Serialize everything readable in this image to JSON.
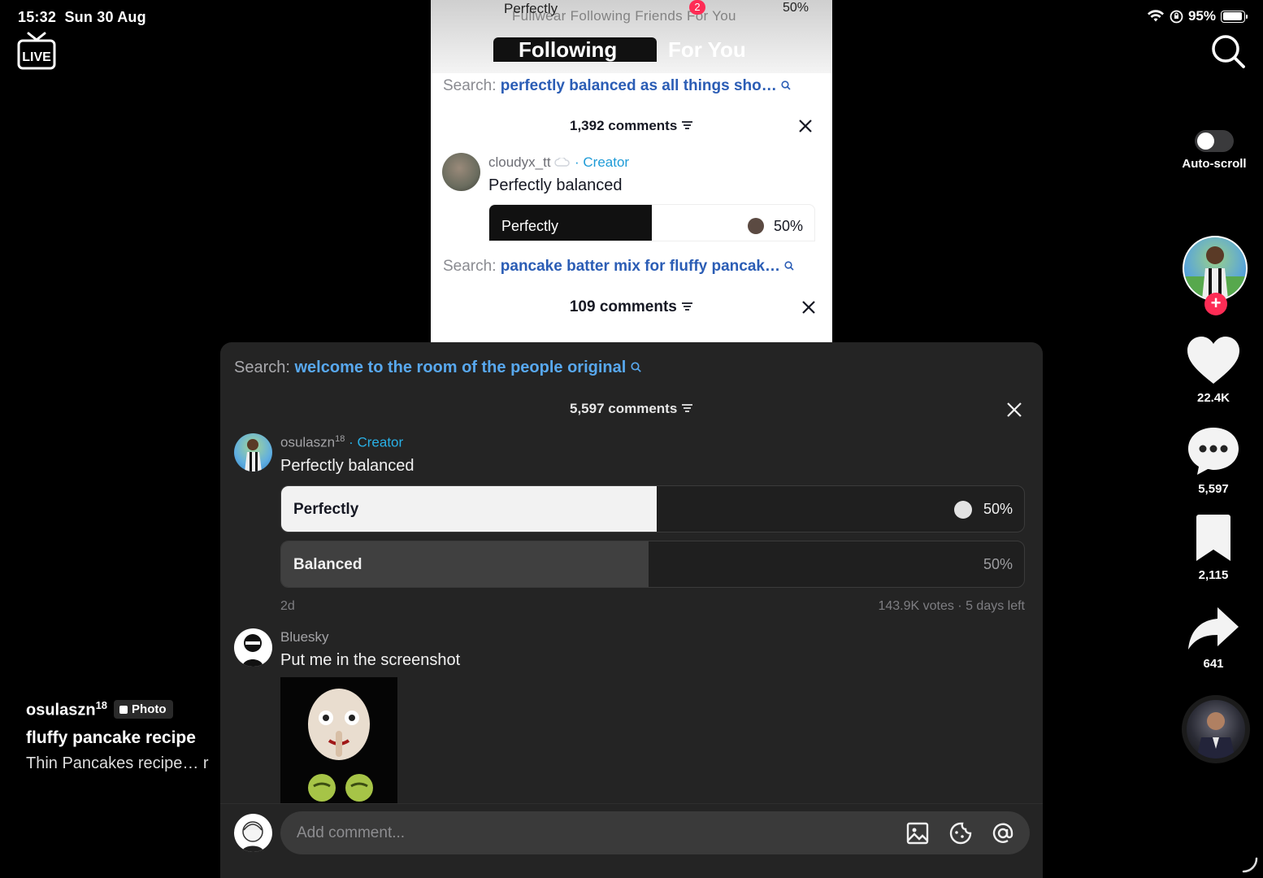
{
  "status": {
    "time": "15:32",
    "date": "Sun 30 Aug",
    "battery": "95%",
    "battery_level": 0.95
  },
  "top": {
    "live_icon": "live-tv-icon",
    "search_icon": "search-icon"
  },
  "autoscroll": {
    "label": "Auto-scroll",
    "enabled": false
  },
  "rail": {
    "likes": "22.4K",
    "comments": "5,597",
    "saves": "2,115",
    "shares": "641"
  },
  "caption": {
    "author": "osulaszn",
    "author_sup": "18",
    "badge": "Photo",
    "title": "fluffy pancake recipe",
    "desc": "Thin Pancakes recipe… r"
  },
  "screenshot": {
    "top_left_label": "Perfectly",
    "top_pct": "50%",
    "top_tabs": "Fullwear  Following  Friends  For You",
    "badge": "2",
    "following": "Following",
    "for_you": "For You",
    "search1_prefix": "Search:",
    "search1_query": "perfectly balanced as all things sho…",
    "count1": "1,392 comments",
    "user": "cloudyx_tt",
    "creator": "· Creator",
    "text": "Perfectly balanced",
    "poll_label": "Perfectly",
    "poll_pct": "50%",
    "poll_fill": 0.5,
    "search2_prefix": "Search:",
    "search2_query": "pancake batter mix for fluffy pancak…",
    "count2": "109 comments"
  },
  "panel": {
    "search_prefix": "Search:",
    "search_query": "welcome to the room of the people original",
    "count": "5,597 comments",
    "comments": [
      {
        "user": "osulaszn",
        "user_sup": "18",
        "creator": "· Creator",
        "text": "Perfectly balanced",
        "poll": [
          {
            "label": "Perfectly",
            "pct": "50%",
            "fill": 0.505,
            "selected": true
          },
          {
            "label": "Balanced",
            "pct": "50%",
            "fill": 0.495,
            "selected": false
          }
        ],
        "age": "2d",
        "votes": "143.9K votes · 5 days left"
      },
      {
        "user": "Bluesky",
        "text": "Put me in the screenshot"
      }
    ],
    "composer_placeholder": "Add comment..."
  },
  "colors": {
    "accent_red": "#fe2c55",
    "creator_blue": "#29b0e6",
    "search_link_blue": "#58a8ee",
    "panel_bg": "#242424"
  }
}
